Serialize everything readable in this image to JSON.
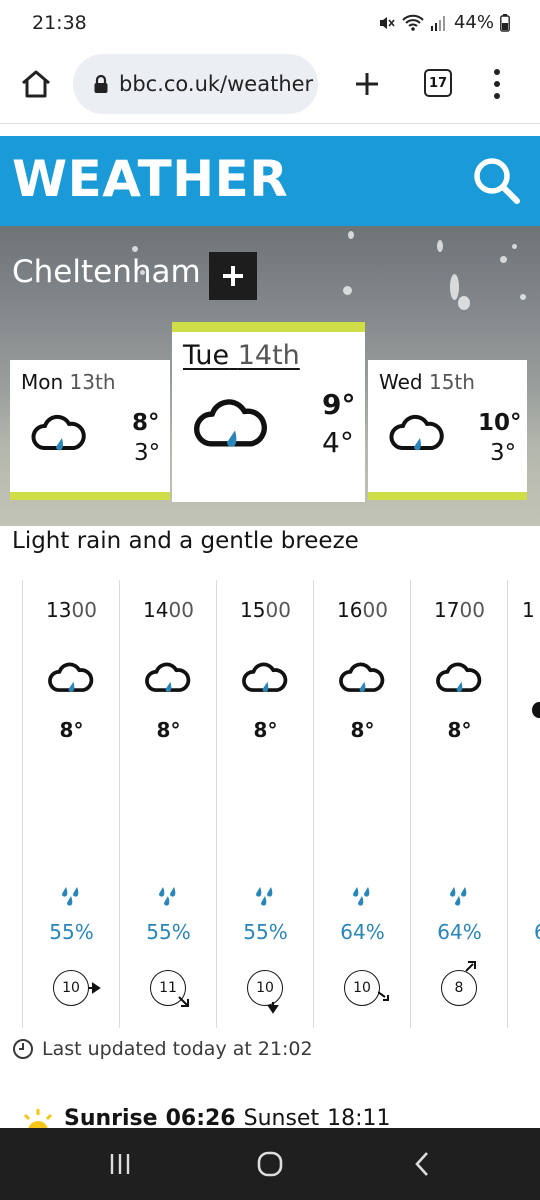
{
  "status": {
    "time": "21:38",
    "battery": "44%"
  },
  "browser": {
    "url": "bbc.co.uk/weather",
    "tab_count": "17"
  },
  "header": {
    "title": "WEATHER"
  },
  "location": {
    "name": "Cheltenham"
  },
  "days": [
    {
      "name": "Mon",
      "date": "13th",
      "high": "8°",
      "low": "3°",
      "icon": "light-rain-cloud-icon"
    },
    {
      "name": "Tue",
      "date": "14th",
      "high": "9°",
      "low": "4°",
      "icon": "light-rain-cloud-icon"
    },
    {
      "name": "Wed",
      "date": "15th",
      "high": "10°",
      "low": "3°",
      "icon": "light-rain-cloud-icon"
    }
  ],
  "summary": "Light rain and a gentle breeze",
  "hours": [
    {
      "h": "13",
      "m": "00",
      "temp": "8°",
      "rain": "55%",
      "wind": "10",
      "wind_dir": "east"
    },
    {
      "h": "14",
      "m": "00",
      "temp": "8°",
      "rain": "55%",
      "wind": "11",
      "wind_dir": "south-east"
    },
    {
      "h": "15",
      "m": "00",
      "temp": "8°",
      "rain": "55%",
      "wind": "10",
      "wind_dir": "south"
    },
    {
      "h": "16",
      "m": "00",
      "temp": "8°",
      "rain": "64%",
      "wind": "10",
      "wind_dir": "south-east"
    },
    {
      "h": "17",
      "m": "00",
      "temp": "8°",
      "rain": "64%",
      "wind": "8",
      "wind_dir": "north-east"
    }
  ],
  "next_hour_partial": {
    "h": "1",
    "rain": "6"
  },
  "updated": "Last updated today at 21:02",
  "sun": {
    "sunrise_label": "Sunrise",
    "sunrise": "06:26",
    "sunset_label": "Sunset",
    "sunset": "18:11"
  },
  "colors": {
    "brand_blue": "#1a9ad6",
    "day_accent": "#cfdd46",
    "rain_blue": "#2a86b8"
  }
}
